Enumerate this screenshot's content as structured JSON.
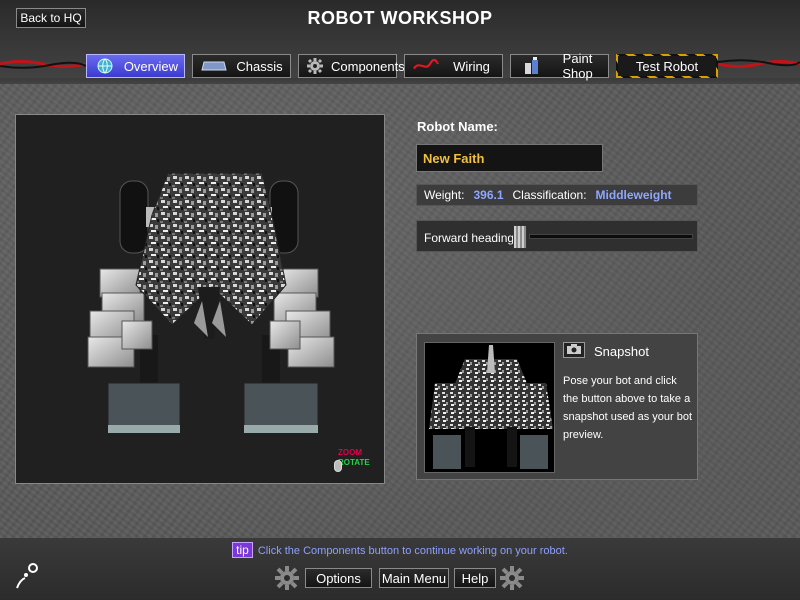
{
  "header": {
    "title": "ROBOT WORKSHOP",
    "back_label": "Back to HQ",
    "tabs": [
      {
        "id": "overview",
        "label": "Overview",
        "icon": "globe-icon",
        "active": true
      },
      {
        "id": "chassis",
        "label": "Chassis",
        "icon": "chassis-icon",
        "active": false
      },
      {
        "id": "components",
        "label": "Components",
        "icon": "gear-icon",
        "active": false
      },
      {
        "id": "wiring",
        "label": "Wiring",
        "icon": "wire-icon",
        "active": false
      },
      {
        "id": "paintshop",
        "label": "Paint Shop",
        "icon": "paint-can-icon",
        "active": false
      },
      {
        "id": "testrobot",
        "label": "Test Robot",
        "icon": "",
        "active": false
      }
    ]
  },
  "viewport": {
    "hint_zoom": "ZOOM",
    "hint_rotate": "ROTATE"
  },
  "robot": {
    "name_label": "Robot Name:",
    "name_value": "New Faith",
    "weight_label": "Weight:",
    "weight_value": "396.1",
    "class_label": "Classification:",
    "class_value": "Middleweight",
    "heading_label": "Forward heading:",
    "heading_value": 0.0
  },
  "snapshot": {
    "title": "Snapshot",
    "description": "Pose your bot and click the button above to take a snapshot used as your bot preview."
  },
  "footer": {
    "tip_badge": "tip",
    "tip_text": "Click the Components button to continue working on your robot.",
    "options_label": "Options",
    "mainmenu_label": "Main Menu",
    "help_label": "Help"
  },
  "colors": {
    "accent_tab": "#4a4ae0",
    "robot_name": "#f0c040",
    "stat_value": "#8fa6ff",
    "tip_text": "#8f9fff",
    "zoom_hint": "#e0004a",
    "rotate_hint": "#29d14a"
  }
}
